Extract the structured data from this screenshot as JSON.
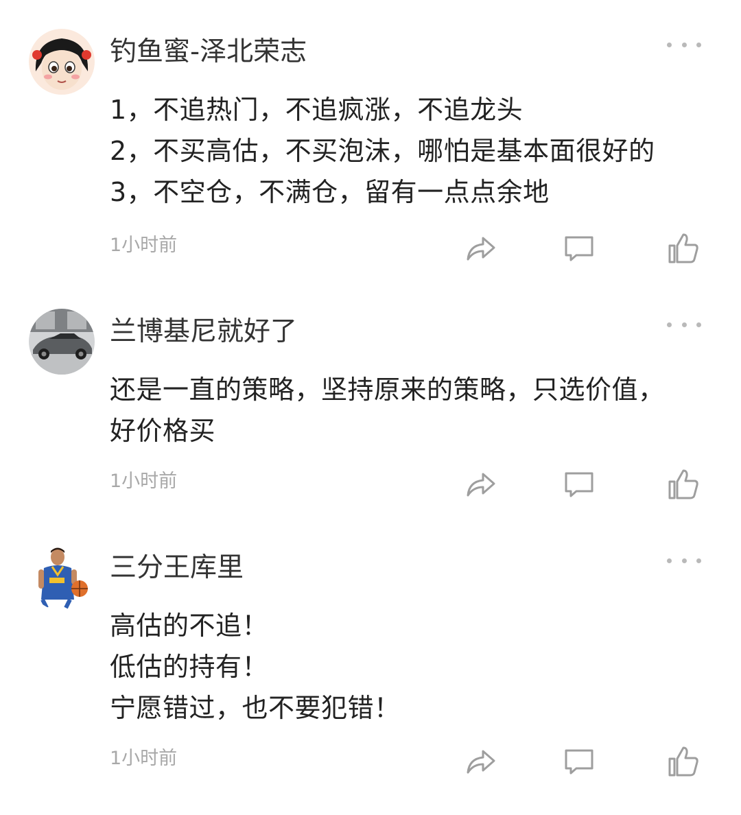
{
  "comments": [
    {
      "user": "钓鱼蜜-泽北荣志",
      "avatar": "cartoon-girl-avatar",
      "lines": [
        "1，不追热门，不追疯涨，不追龙头",
        "2，不买高估，不买泡沫，哪怕是基本面很好的",
        "3，不空仓，不满仓，留有一点点余地"
      ],
      "time": "1小时前"
    },
    {
      "user": "兰博基尼就好了",
      "avatar": "sports-car-avatar",
      "lines": [
        "还是一直的策略，坚持原来的策略，只选价值，",
        "好价格买"
      ],
      "time": "1小时前"
    },
    {
      "user": "三分王库里",
      "avatar": "basketball-player-avatar",
      "lines": [
        "高估的不追！",
        "低估的持有！",
        "宁愿错过，也不要犯错！"
      ],
      "time": "1小时前"
    }
  ],
  "icons": {
    "more": "more-dots-icon",
    "share": "share-icon",
    "reply": "comment-bubble-icon",
    "like": "thumbs-up-icon"
  },
  "colors": {
    "text": "#222222",
    "username": "#333333",
    "timestamp": "#a8a8a8",
    "icon": "#9e9e9e"
  }
}
